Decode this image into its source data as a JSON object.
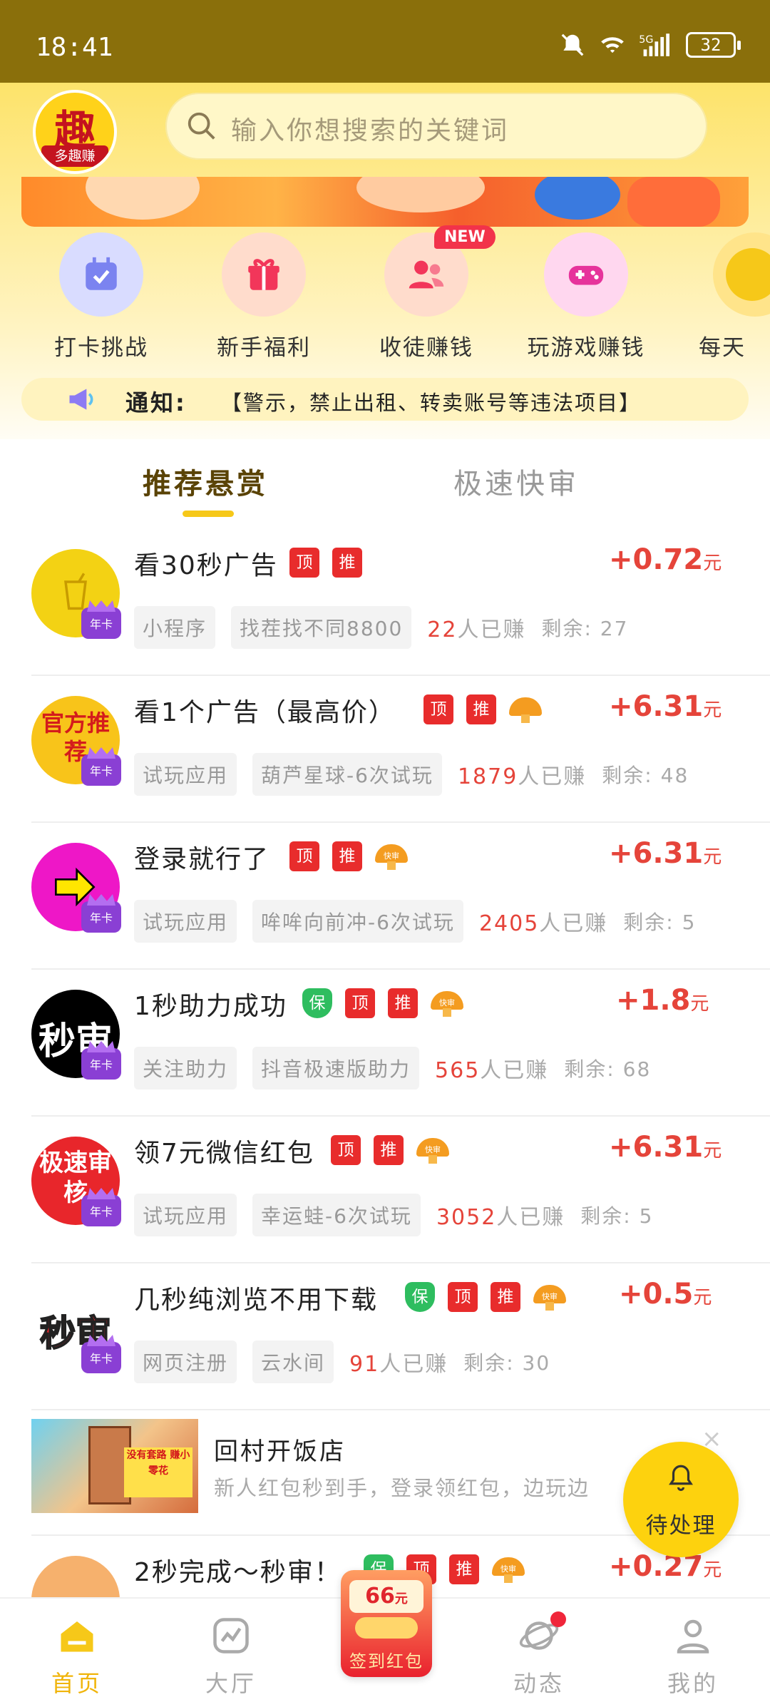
{
  "status_bar": {
    "time": "18:41",
    "battery": "32"
  },
  "header": {
    "logo_big": "趣",
    "logo_small": "多趣赚",
    "search_placeholder": "输入你想搜索的关键词"
  },
  "quick_actions": [
    {
      "label": "打卡挑战",
      "icon": "calendar-check-icon",
      "color": "#d9dcff"
    },
    {
      "label": "新手福利",
      "icon": "gift-icon",
      "color": "#ffdccc",
      "badge": ""
    },
    {
      "label": "收徒赚钱",
      "icon": "users-icon",
      "color": "#ffdccc",
      "badge": "NEW"
    },
    {
      "label": "玩游戏赚钱",
      "icon": "gamepad-icon",
      "color": "#ffd7ef"
    },
    {
      "label": "每天",
      "icon": "coin-icon",
      "color": "#ffe48a"
    }
  ],
  "notice": {
    "title": "通知:",
    "text": "【警示，禁止出租、转卖账号等违法项目】"
  },
  "tabs": [
    {
      "label": "推荐悬赏"
    },
    {
      "label": "极速快审"
    }
  ],
  "tasks": [
    {
      "title": "看30秒广告",
      "bao": false,
      "ding": "顶",
      "tui": "推",
      "fast": false,
      "price": "+0.72",
      "unit": "元",
      "category": "小程序",
      "project": "找茬找不同8800",
      "earned_count": "22",
      "earned_suffix": "人已赚",
      "remain": "剩余: 27",
      "avatar_text": "",
      "avatar_color": "#f3d214",
      "nianka": "年卡"
    },
    {
      "title": "看1个广告（最高价）",
      "bao": false,
      "ding": "顶",
      "tui": "推",
      "fast": true,
      "price": "+6.31",
      "unit": "元",
      "category": "试玩应用",
      "project": "葫芦星球-6次试玩",
      "earned_count": "1879",
      "earned_suffix": "人已赚",
      "remain": "剩余: 48",
      "avatar_text": "官方推荐",
      "avatar_color": "#f8c41a",
      "nianka": "年卡"
    },
    {
      "title": "登录就行了",
      "bao": false,
      "ding": "顶",
      "tui": "推",
      "fast": true,
      "fast_label": "快审",
      "price": "+6.31",
      "unit": "元",
      "category": "试玩应用",
      "project": "哞哞向前冲-6次试玩",
      "earned_count": "2405",
      "earned_suffix": "人已赚",
      "remain": "剩余: 5",
      "avatar_text": "",
      "avatar_color": "#ee17c7",
      "nianka": "年卡"
    },
    {
      "title": "1秒助力成功",
      "bao": true,
      "bao_label": "保",
      "ding": "顶",
      "tui": "推",
      "fast": true,
      "fast_label": "快审",
      "price": "+1.8",
      "unit": "元",
      "category": "关注助力",
      "project": "抖音极速版助力",
      "earned_count": "565",
      "earned_suffix": "人已赚",
      "remain": "剩余: 68",
      "avatar_text": "秒审",
      "avatar_color": "#000000",
      "nianka": "年卡"
    },
    {
      "title": "领7元微信红包",
      "bao": false,
      "ding": "顶",
      "tui": "推",
      "fast": true,
      "fast_label": "快审",
      "price": "+6.31",
      "unit": "元",
      "category": "试玩应用",
      "project": "幸运蛙-6次试玩",
      "earned_count": "3052",
      "earned_suffix": "人已赚",
      "remain": "剩余: 5",
      "avatar_text": "极速审核",
      "avatar_color": "#e8262b",
      "nianka": "年卡"
    },
    {
      "title": "几秒纯浏览不用下载",
      "bao": true,
      "bao_label": "保",
      "ding": "顶",
      "tui": "推",
      "fast": true,
      "fast_label": "快审",
      "price": "+0.5",
      "unit": "元",
      "category": "网页注册",
      "project": "云水间",
      "earned_count": "91",
      "earned_suffix": "人已赚",
      "remain": "剩余: 30",
      "avatar_text": "秒审",
      "avatar_color": "#ffffff",
      "nianka": "年卡"
    },
    {
      "title": "2秒完成～秒审！",
      "bao": true,
      "bao_label": "保",
      "ding": "顶",
      "tui": "推",
      "fast": true,
      "fast_label": "快审",
      "price": "+0.27",
      "unit": "元",
      "avatar_color": "#f6b16d"
    }
  ],
  "ad": {
    "title": "回村开饭店",
    "subtitle": "新人红包秒到手，登录领红包，边玩边",
    "close": "×",
    "image_text": "没有套路 赚小零花"
  },
  "pending": {
    "label": "待处理"
  },
  "bottom_nav": {
    "home": "首页",
    "hall": "大厅",
    "hongbao_amount": "66",
    "hongbao_unit": "元",
    "hongbao_label": "签到红包",
    "dynamic": "动态",
    "mine": "我的"
  },
  "colors": {
    "accent": "#f6c819",
    "price": "#e5443a",
    "ding": "#e82c2c",
    "bao": "#2ebd5f",
    "fast": "#f49c20"
  }
}
